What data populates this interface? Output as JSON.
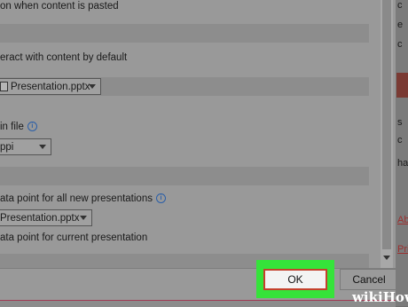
{
  "settings": {
    "paste_option_text": "on when content is pasted",
    "interact_text": "eract with content by default",
    "default_file_dropdown": "Presentation.pptx",
    "in_file_label": "in file",
    "resolution_dropdown": "ppi",
    "data_point_new_text": "ata point for all new presentations",
    "data_point_file_dropdown": "Presentation.pptx",
    "data_point_current_text": "ata point for current presentation"
  },
  "right_panel": {
    "line1": "c",
    "line2": "e",
    "line3": "c",
    "line4": "s",
    "line5": "c",
    "line6": "ha",
    "link1": "Ab",
    "link2": "Pri"
  },
  "footer": {
    "ok_label": "OK",
    "cancel_label": "Cancel"
  },
  "watermark": {
    "brand": "wikiHow"
  },
  "colors": {
    "highlight": "#35e33a",
    "ok_border": "#c4402c",
    "link": "#9c2f2f"
  }
}
